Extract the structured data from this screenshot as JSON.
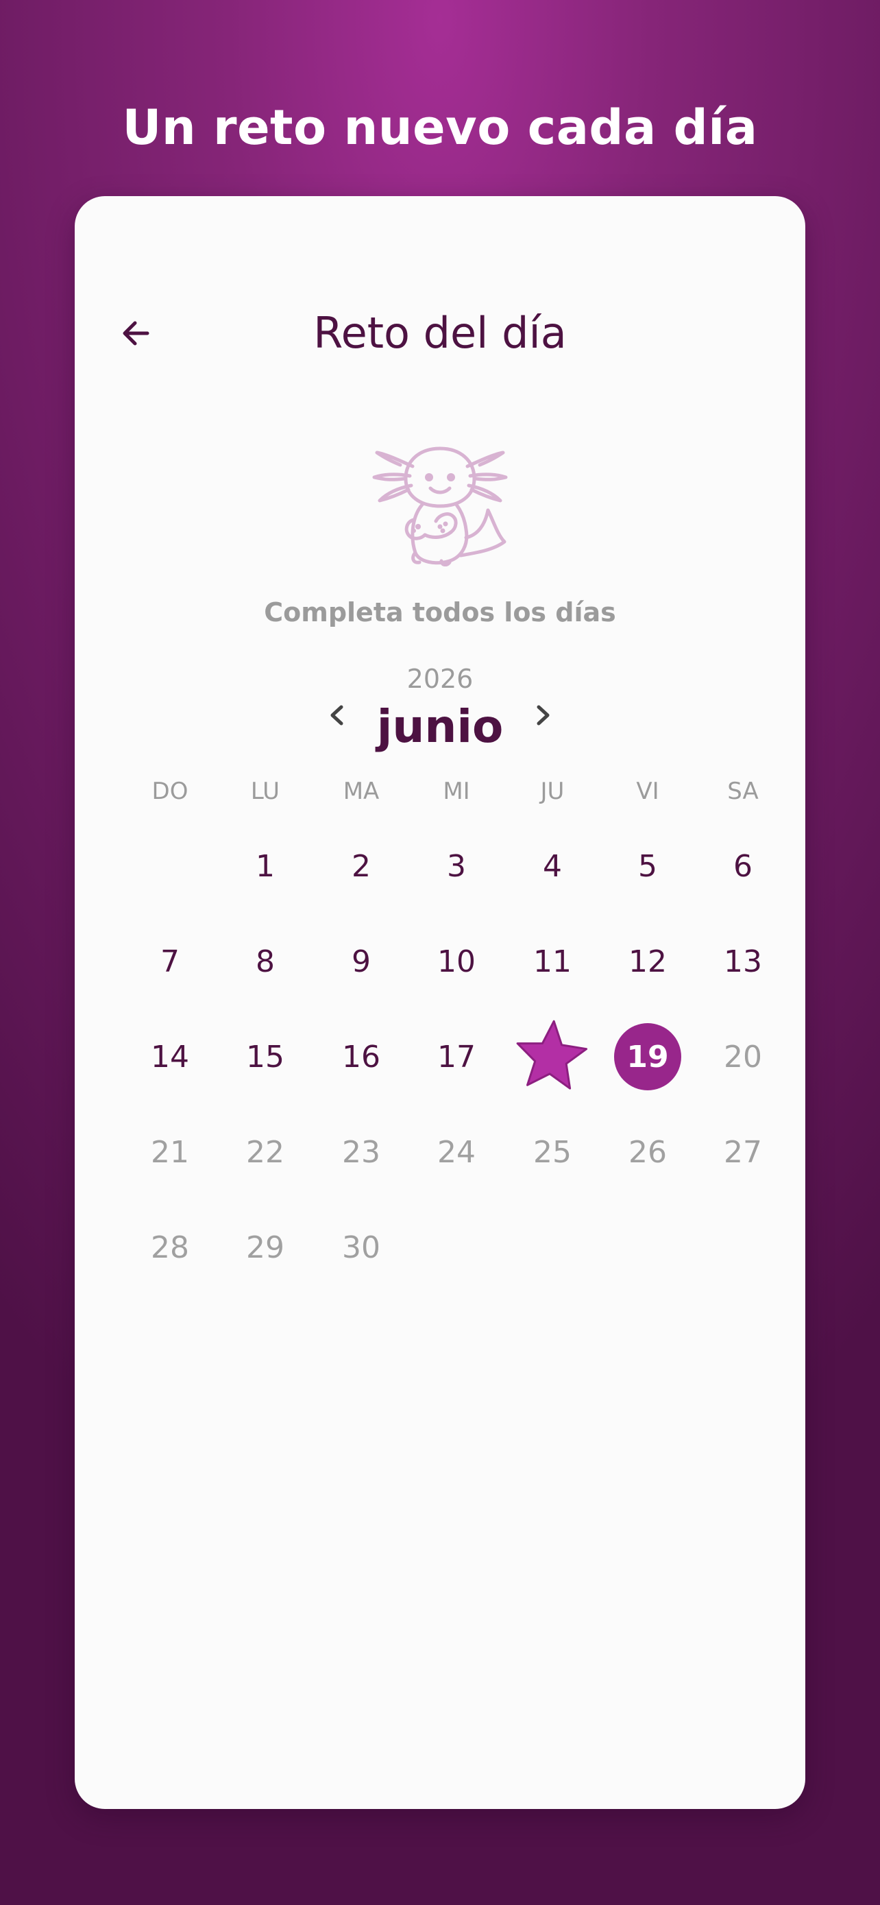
{
  "headline": "Un reto nuevo cada día",
  "screen": {
    "title": "Reto del día",
    "subtitle": "Completa todos los días"
  },
  "calendar": {
    "year": "2026",
    "month": "junio",
    "weekdays": [
      "DO",
      "LU",
      "MA",
      "MI",
      "JU",
      "VI",
      "SA"
    ],
    "first_weekday_index": 1,
    "days_in_month": 30,
    "today": 19,
    "completed_days": [
      18
    ],
    "future_from": 20
  },
  "colors": {
    "accent": "#98268b",
    "star": "#b32fa5",
    "text_dark": "#4d1242",
    "text_muted": "#9b9b9b",
    "mascot": "#d8b3d2"
  },
  "icons": {
    "back": "arrow-left-icon",
    "prev": "chevron-left-icon",
    "next": "chevron-right-icon",
    "completed": "star-icon",
    "mascot": "axolotl-icon"
  }
}
